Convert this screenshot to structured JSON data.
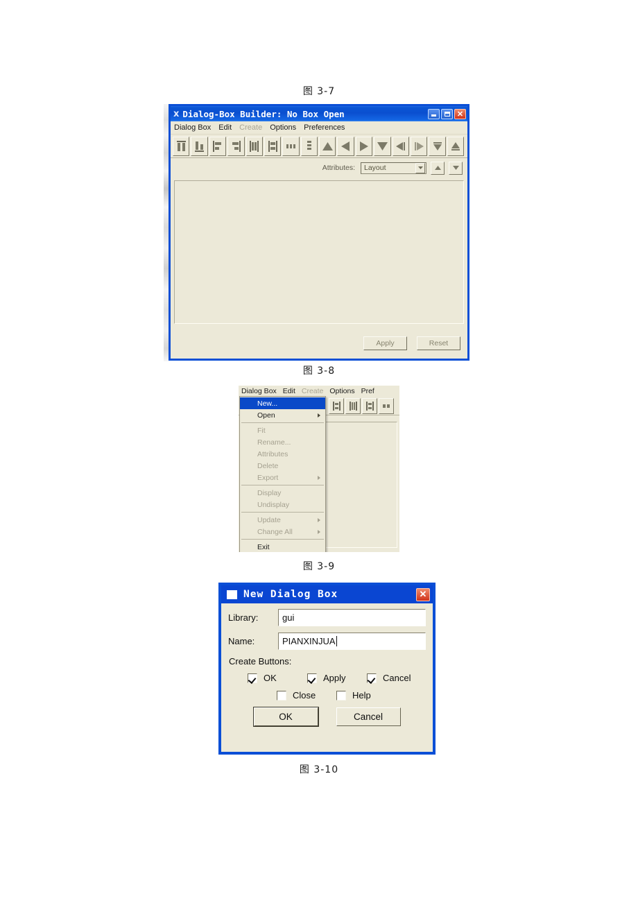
{
  "captions": {
    "fig37": "图 3-7",
    "fig38": "图 3-8",
    "fig39": "图 3-9",
    "fig310": "图 3-10"
  },
  "colors": {
    "titlebar_blue": "#0a4fd0",
    "dialog_blue": "#0a46d2",
    "window_face": "#ece9d8",
    "selection_blue": "#0a49c8",
    "close_red": "#d0331a"
  },
  "builder_window": {
    "title": "Dialog-Box Builder: No Box Open",
    "title_icon": "x-logo-icon",
    "window_buttons": [
      {
        "name": "minimize-button",
        "glyph": "_"
      },
      {
        "name": "maximize-button",
        "glyph": "□"
      },
      {
        "name": "close-button",
        "glyph": "✕"
      }
    ],
    "menus": [
      {
        "label": "Dialog Box",
        "disabled": false
      },
      {
        "label": "Edit",
        "disabled": false
      },
      {
        "label": "Create",
        "disabled": true
      },
      {
        "label": "Options",
        "disabled": false
      },
      {
        "label": "Preferences",
        "disabled": false
      }
    ],
    "toolbar": [
      {
        "name": "align-top-icon"
      },
      {
        "name": "align-bottom-icon"
      },
      {
        "name": "align-left-icon"
      },
      {
        "name": "align-right-icon"
      },
      {
        "name": "align-center-vertical-icon"
      },
      {
        "name": "align-center-horizontal-icon"
      },
      {
        "name": "distribute-columns-icon"
      },
      {
        "name": "distribute-rows-icon"
      },
      {
        "name": "move-up-icon"
      },
      {
        "name": "move-left-icon"
      },
      {
        "name": "move-right-icon"
      },
      {
        "name": "move-down-icon"
      },
      {
        "name": "shrink-left-icon"
      },
      {
        "name": "shrink-right-icon"
      },
      {
        "name": "shrink-down-icon"
      },
      {
        "name": "shrink-up-icon"
      }
    ],
    "attributes_bar": {
      "label": "Attributes:",
      "combo_value": "Layout",
      "combo_options": [
        "Layout"
      ],
      "up_button": "spin-up-icon",
      "down_button": "spin-down-icon"
    },
    "footer": {
      "apply_label": "Apply",
      "reset_label": "Reset"
    }
  },
  "menu_screenshot": {
    "menus": [
      {
        "label": "Dialog Box",
        "disabled": false
      },
      {
        "label": "Edit",
        "disabled": false
      },
      {
        "label": "Create",
        "disabled": true
      },
      {
        "label": "Options",
        "disabled": false
      },
      {
        "label": "Pref",
        "disabled": false
      }
    ],
    "dropdown_items": [
      {
        "label": "New...",
        "state": "selected",
        "submenu": false
      },
      {
        "label": "Open",
        "state": "enabled",
        "submenu": true
      },
      {
        "separator": true
      },
      {
        "label": "Fit",
        "state": "disabled",
        "submenu": false
      },
      {
        "label": "Rename...",
        "state": "disabled",
        "submenu": false
      },
      {
        "label": "Attributes",
        "state": "disabled",
        "submenu": false
      },
      {
        "label": "Delete",
        "state": "disabled",
        "submenu": false
      },
      {
        "label": "Export",
        "state": "disabled",
        "submenu": true
      },
      {
        "separator": true
      },
      {
        "label": "Display",
        "state": "disabled",
        "submenu": false
      },
      {
        "label": "Undisplay",
        "state": "disabled",
        "submenu": false
      },
      {
        "separator": true
      },
      {
        "label": "Update",
        "state": "disabled",
        "submenu": true
      },
      {
        "label": "Change All",
        "state": "disabled",
        "submenu": true
      },
      {
        "separator": true
      },
      {
        "label": "Exit",
        "state": "enabled",
        "submenu": false
      }
    ]
  },
  "new_dialog": {
    "title": "New Dialog Box",
    "title_icon": "window-square-icon",
    "close_glyph": "✕",
    "library": {
      "label": "Library:",
      "value": "gui",
      "placeholder": ""
    },
    "name": {
      "label": "Name:",
      "value": "PIANXINJUA",
      "placeholder": ""
    },
    "create_buttons_label": "Create Buttons:",
    "checkboxes": [
      {
        "label": "OK",
        "checked": true
      },
      {
        "label": "Apply",
        "checked": true
      },
      {
        "label": "Cancel",
        "checked": true
      },
      {
        "label": "Close",
        "checked": false
      },
      {
        "label": "Help",
        "checked": false
      }
    ],
    "ok_label": "OK",
    "cancel_label": "Cancel"
  }
}
